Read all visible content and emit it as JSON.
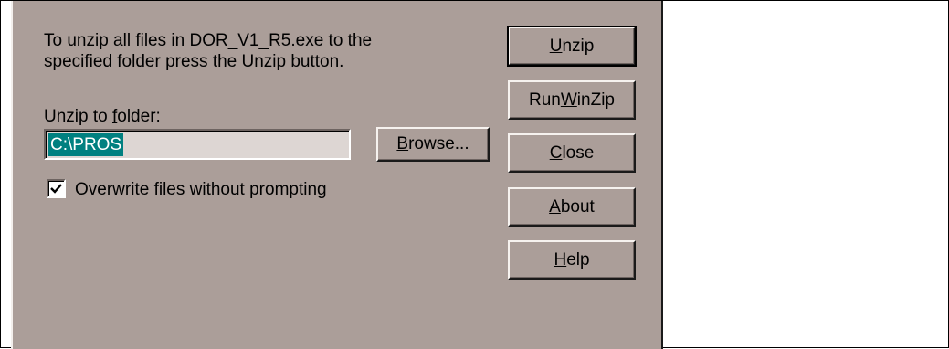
{
  "dialog": {
    "message": "To unzip all files in DOR_V1_R5.exe to the\nspecified folder press the Unzip button.",
    "folder_label_pre": "Unzip to ",
    "folder_label_key": "f",
    "folder_label_post": "older:",
    "folder_value": "C:\\PROS",
    "browse": {
      "pre": "",
      "key": "B",
      "post": "rowse..."
    },
    "overwrite": {
      "checked": true,
      "pre": "",
      "key": "O",
      "post": "verwrite files without prompting"
    },
    "buttons": {
      "unzip": {
        "pre": "",
        "key": "U",
        "post": "nzip"
      },
      "run_winzip": {
        "pre": "Run ",
        "key": "W",
        "post": "inZip"
      },
      "close": {
        "pre": "",
        "key": "C",
        "post": "lose"
      },
      "about": {
        "pre": "",
        "key": "A",
        "post": "bout"
      },
      "help": {
        "pre": "",
        "key": "H",
        "post": "elp"
      }
    }
  },
  "colors": {
    "dialog_bg": "#ab9e99",
    "selection": "#008080"
  }
}
